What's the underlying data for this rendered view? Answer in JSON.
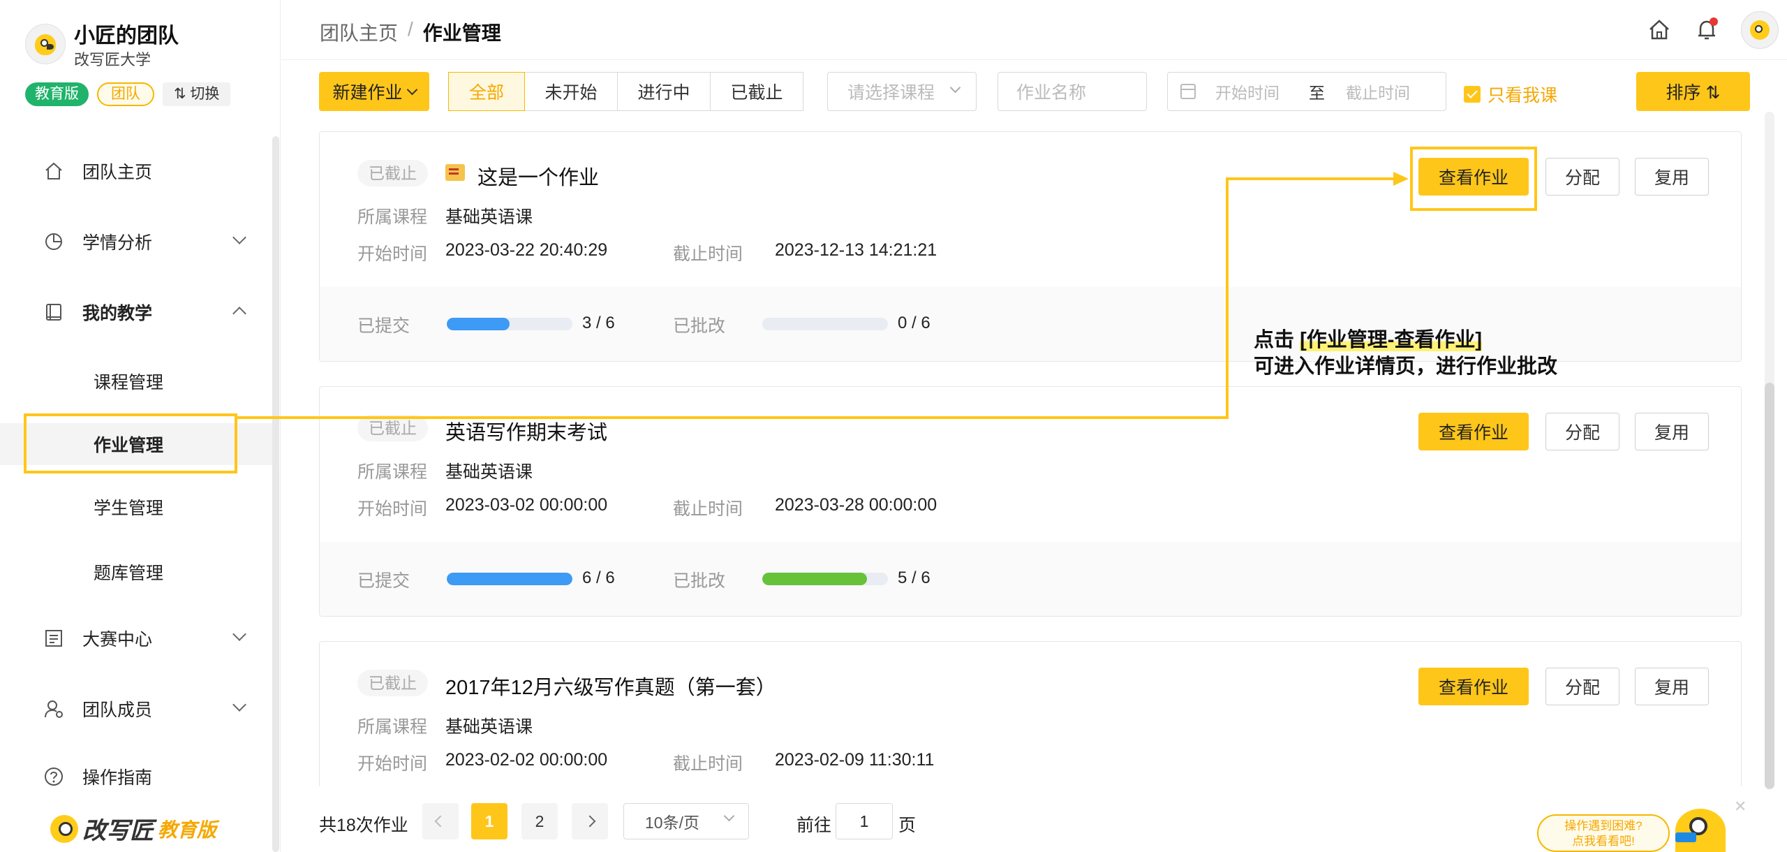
{
  "team": {
    "name": "小匠的团队",
    "school": "改写匠大学",
    "tag_edu": "教育版",
    "tag_team": "团队",
    "switch_label": "⇅ 切换"
  },
  "sidebar": {
    "items": [
      {
        "label": "团队主页",
        "icon": "home-icon"
      },
      {
        "label": "学情分析",
        "icon": "pie-chart-icon"
      },
      {
        "label": "我的教学",
        "icon": "book-icon"
      },
      {
        "label": "课程管理"
      },
      {
        "label": "作业管理"
      },
      {
        "label": "学生管理"
      },
      {
        "label": "题库管理"
      },
      {
        "label": "大赛中心",
        "icon": "contest-icon"
      },
      {
        "label": "团队成员",
        "icon": "member-icon"
      },
      {
        "label": "操作指南",
        "icon": "help-icon"
      }
    ],
    "brand_name": "改写匠",
    "brand_sub": "教育版"
  },
  "header": {
    "breadcrumb_root": "团队主页",
    "breadcrumb_sep": "/",
    "breadcrumb_current": "作业管理"
  },
  "toolbar": {
    "new_label": "新建作业",
    "tabs": [
      "全部",
      "未开始",
      "进行中",
      "已截止"
    ],
    "course_placeholder": "请选择课程",
    "name_placeholder": "作业名称",
    "start_placeholder": "开始时间",
    "to_label": "至",
    "end_placeholder": "截止时间",
    "only_mine": "只看我课",
    "sort_label": "排序 ⇅"
  },
  "labels": {
    "course": "所属课程",
    "start": "开始时间",
    "end": "截止时间",
    "submitted": "已提交",
    "graded": "已批改",
    "view": "查看作业",
    "assign": "分配",
    "reuse": "复用"
  },
  "assignments": [
    {
      "status": "已截止",
      "title": "这是一个作业",
      "course": "基础英语课",
      "start": "2023-03-22 20:40:29",
      "end": "2023-12-13 14:21:21",
      "submitted": "3 / 6",
      "submitted_frac": 0.5,
      "graded": "0 / 6",
      "graded_frac": 0
    },
    {
      "status": "已截止",
      "title": "英语写作期末考试",
      "course": "基础英语课",
      "start": "2023-03-02 00:00:00",
      "end": "2023-03-28 00:00:00",
      "submitted": "6 / 6",
      "submitted_frac": 1,
      "graded": "5 / 6",
      "graded_frac": 0.833
    },
    {
      "status": "已截止",
      "title": "2017年12月六级写作真题（第一套）",
      "course": "基础英语课",
      "start": "2023-02-02 00:00:00",
      "end": "2023-02-09 11:30:11",
      "submitted": "",
      "graded": ""
    }
  ],
  "pagination": {
    "total": "共18次作业",
    "pages": [
      "1",
      "2"
    ],
    "size": "10条/页",
    "goto": "前往",
    "goto_value": "1",
    "page_unit": "页"
  },
  "annotation": {
    "line1_prefix": "点击 ",
    "line1_highlight": "[作业管理-查看作业]",
    "line2": "可进入作业详情页，进行作业批改"
  },
  "help": {
    "line1": "操作遇到困难?",
    "line2": "点我看看吧!"
  },
  "colors": {
    "accent": "#ffc61a",
    "submitted_bar": "#3d9af5",
    "graded_bar": "#67c23a",
    "edu_green": "#20b36b"
  }
}
